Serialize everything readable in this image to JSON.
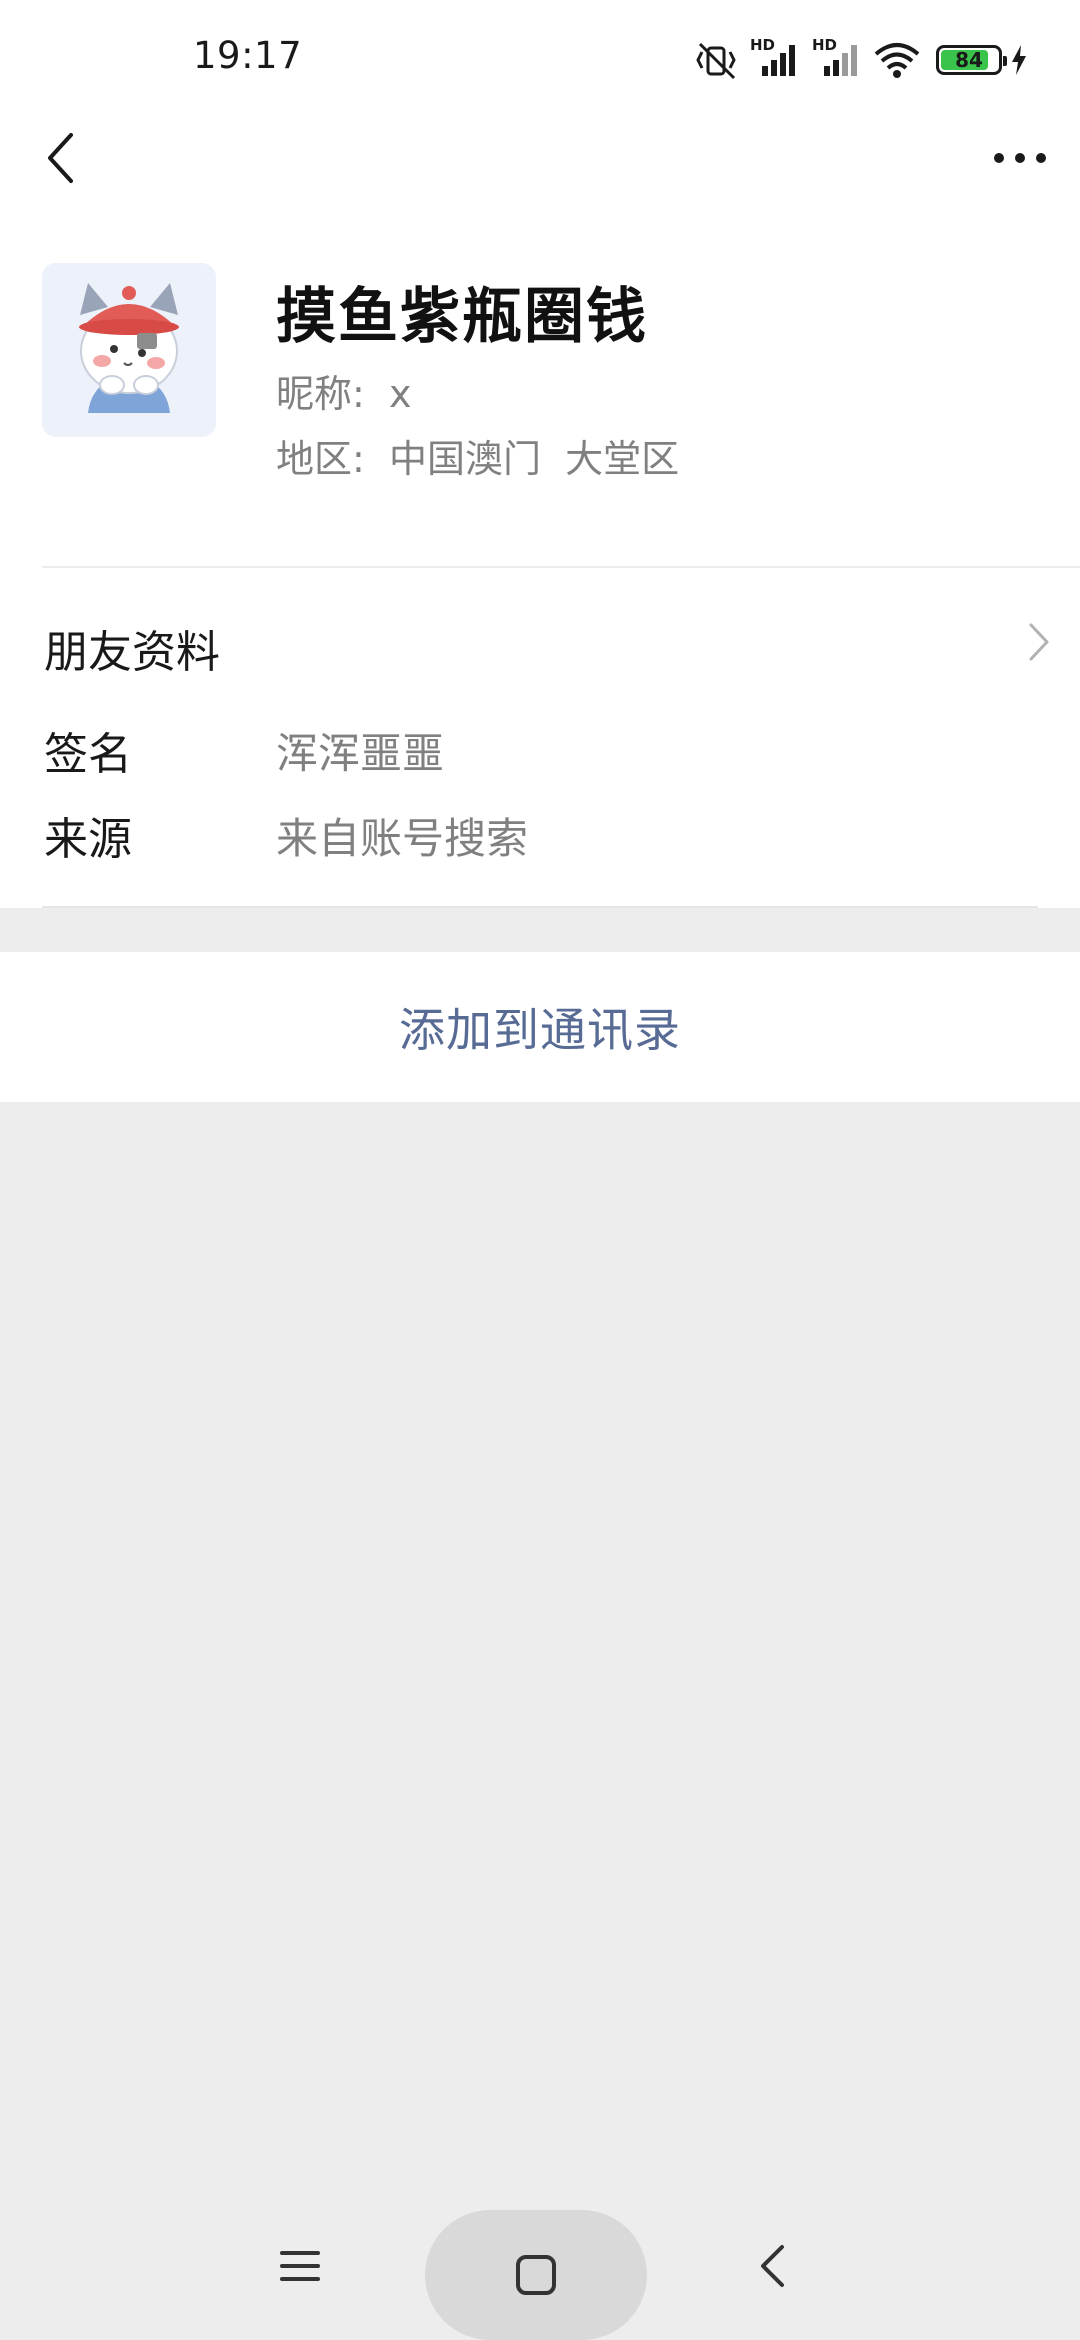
{
  "status_bar": {
    "time": "19:17",
    "signal_labels": [
      "HD",
      "HD"
    ],
    "battery_level": "84",
    "battery_percent": 84,
    "icons": [
      "mute-vibrate-icon",
      "signal-hd-icon",
      "signal-hd-icon",
      "wifi-icon",
      "battery-icon",
      "charging-bolt-icon"
    ]
  },
  "nav": {
    "icons": [
      "back-arrow-icon",
      "more-dots-icon"
    ]
  },
  "profile": {
    "name": "摸鱼紫瓶圈钱",
    "nickname": "昵称:  x",
    "region": "地区:  中国澳门  大堂区"
  },
  "info": {
    "friend_profile_label": "朋友资料",
    "signature_label": "签名",
    "signature_value": "浑浑噩噩",
    "source_label": "来源",
    "source_value": "来自账号搜索"
  },
  "actions": {
    "add_to_contacts": "添加到通讯录"
  },
  "colors": {
    "accent_link": "#576b95",
    "page_bg": "#ededed",
    "battery_green": "#3bc44b"
  },
  "system_nav": {
    "icons": [
      "menu-icon",
      "home-icon",
      "back-icon"
    ]
  }
}
